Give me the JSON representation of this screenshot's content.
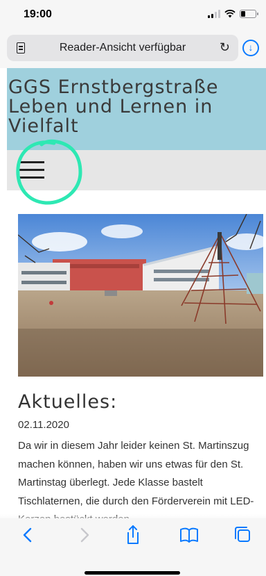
{
  "status_bar": {
    "time": "19:00"
  },
  "browser": {
    "address_text": "Reader-Ansicht verfügbar"
  },
  "site": {
    "title_line1": "GGS Ernstbergstraße",
    "title_line2": "Leben und Lernen in",
    "title_line3": "Vielfalt"
  },
  "article": {
    "heading": "Aktuelles:",
    "date": "02.11.2020",
    "body": "Da wir in diesem Jahr leider keinen St. Martinszug machen können, haben wir uns etwas für den St. Martinstag überlegt.  Jede Klasse bastelt Tischlaternen, die durch den Förderverein mit LED-Kerzen bestückt werden."
  },
  "colors": {
    "header_bg": "#9fd0dd",
    "menu_bg": "#e6e6e6",
    "annotation": "#2ee8b3",
    "ios_blue": "#0a7aff"
  },
  "icons": {
    "reader": "reader-icon",
    "reload": "reload-icon",
    "download": "download-icon",
    "menu": "hamburger-menu-icon",
    "back": "chevron-left-icon",
    "forward": "chevron-right-icon",
    "share": "share-icon",
    "bookmarks": "book-icon",
    "tabs": "tabs-icon"
  },
  "battery_level": 0.3
}
